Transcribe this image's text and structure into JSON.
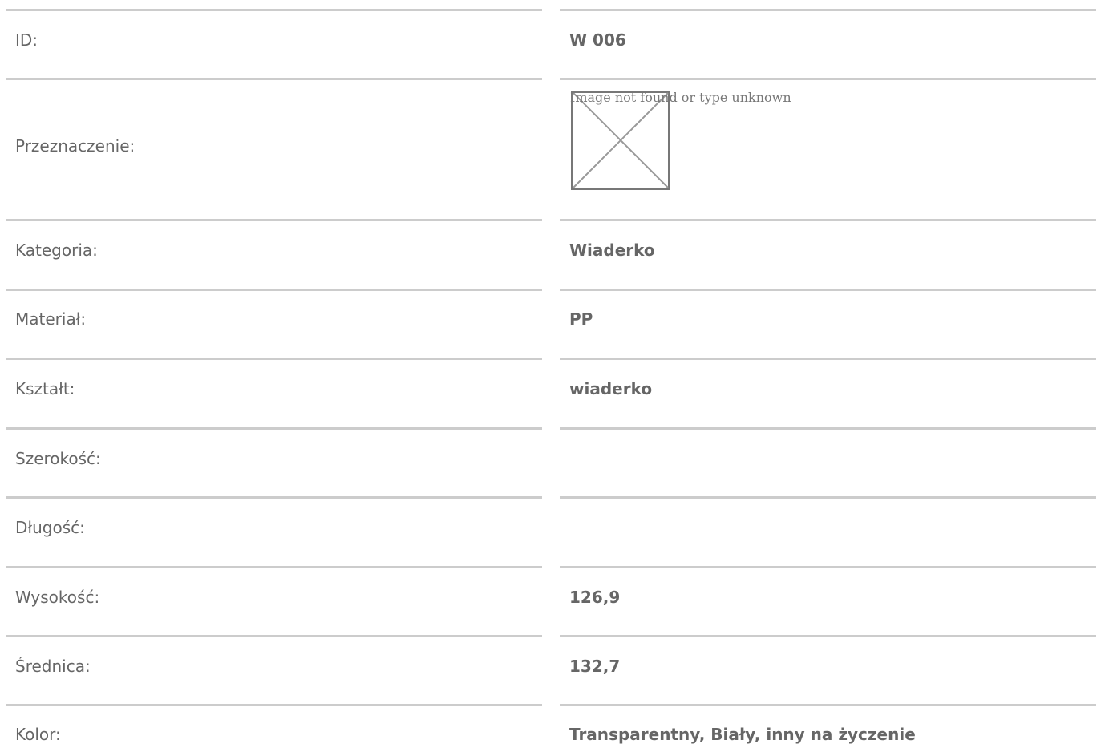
{
  "colors": {
    "text": "#666666",
    "divider": "#cccccc",
    "background": "#ffffff"
  },
  "rows": [
    {
      "label": "ID:",
      "value": "W 006"
    },
    {
      "label": "Przeznaczenie:",
      "value": "",
      "image_alt": "Image not found or type unknown",
      "icon": "broken-image-icon"
    },
    {
      "label": "Kategoria:",
      "value": "Wiaderko"
    },
    {
      "label": "Materiał:",
      "value": "PP"
    },
    {
      "label": "Kształt:",
      "value": "wiaderko"
    },
    {
      "label": "Szerokość:",
      "value": ""
    },
    {
      "label": "Długość:",
      "value": ""
    },
    {
      "label": "Wysokość:",
      "value": "126,9"
    },
    {
      "label": "Średnica:",
      "value": "132,7"
    },
    {
      "label": "Kolor:",
      "value": "Transparentny, Biały, inny na życzenie"
    }
  ]
}
